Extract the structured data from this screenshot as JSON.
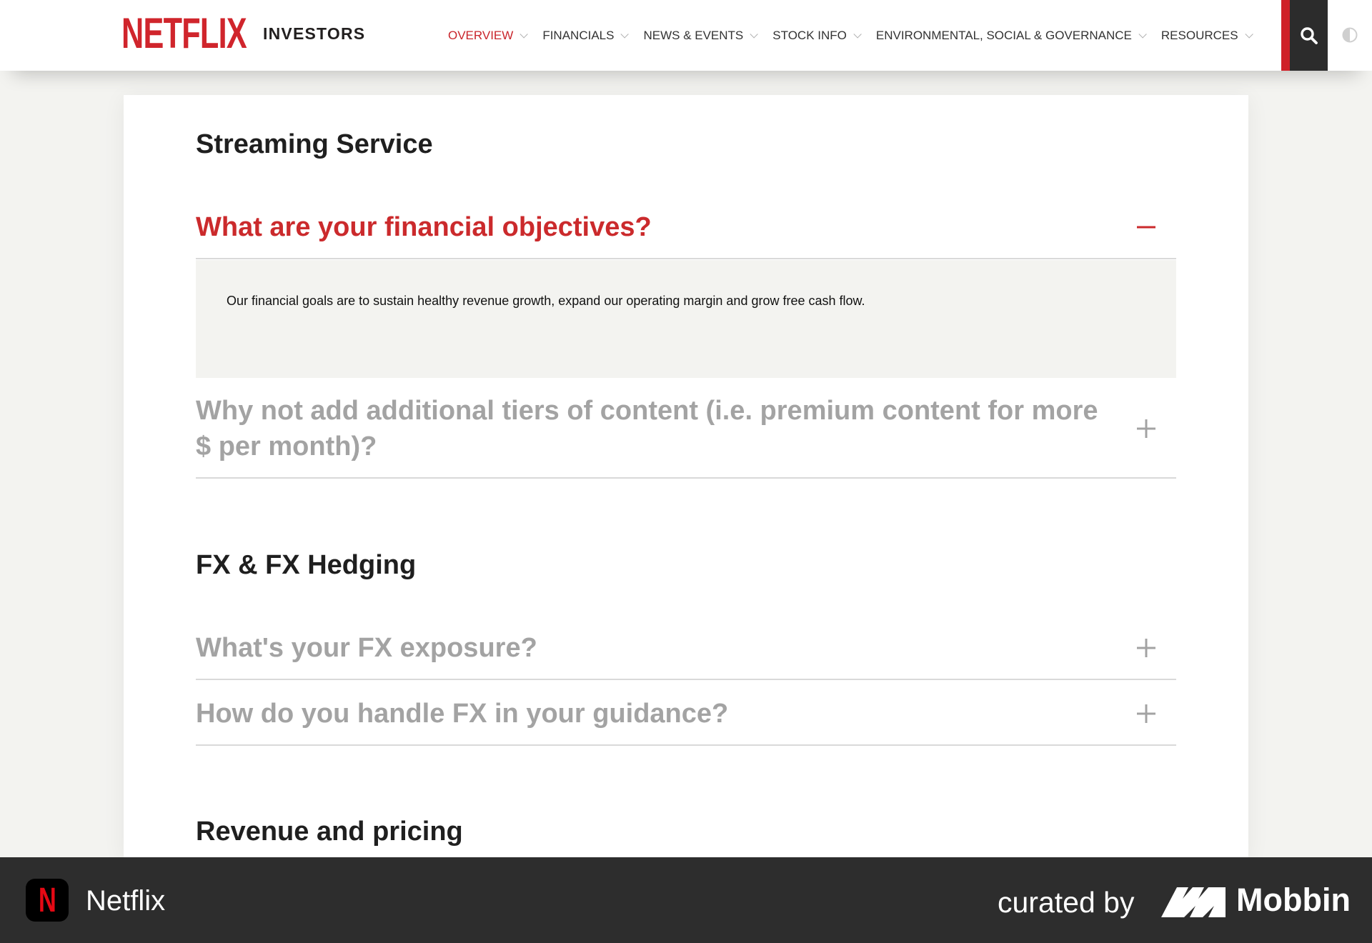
{
  "header": {
    "logo": "NETFLIX",
    "logo_sub": "INVESTORS",
    "nav": [
      {
        "label": "OVERVIEW",
        "active": true
      },
      {
        "label": "FINANCIALS",
        "active": false
      },
      {
        "label": "NEWS & EVENTS",
        "active": false
      },
      {
        "label": "STOCK INFO",
        "active": false
      },
      {
        "label": "ENVIRONMENTAL, SOCIAL & GOVERNANCE",
        "active": false
      },
      {
        "label": "RESOURCES",
        "active": false
      }
    ],
    "icons": {
      "search": "search-icon",
      "contrast": "contrast-icon"
    }
  },
  "sections": [
    {
      "title": "Streaming Service",
      "faqs": [
        {
          "question": "What are your financial objectives?",
          "open": true,
          "answer": "Our financial goals are to sustain healthy revenue growth, expand our operating margin and grow free cash flow."
        },
        {
          "question": "Why not add additional tiers of content (i.e. premium content for more $ per month)?",
          "open": false
        }
      ]
    },
    {
      "title": "FX & FX Hedging",
      "faqs": [
        {
          "question": "What's your FX exposure?",
          "open": false
        },
        {
          "question": "How do you handle FX in your guidance?",
          "open": false
        }
      ]
    },
    {
      "title": "Revenue and pricing"
    }
  ],
  "footer": {
    "app_icon_letter": "N",
    "app_name": "Netflix",
    "curated_by": "curated by",
    "brand": "Mobbin"
  },
  "colors": {
    "brand_red": "#d0252c",
    "open_question": "#cb2a2c",
    "closed_question": "#a3a3a3",
    "footer_bg": "#2d2d2d"
  }
}
